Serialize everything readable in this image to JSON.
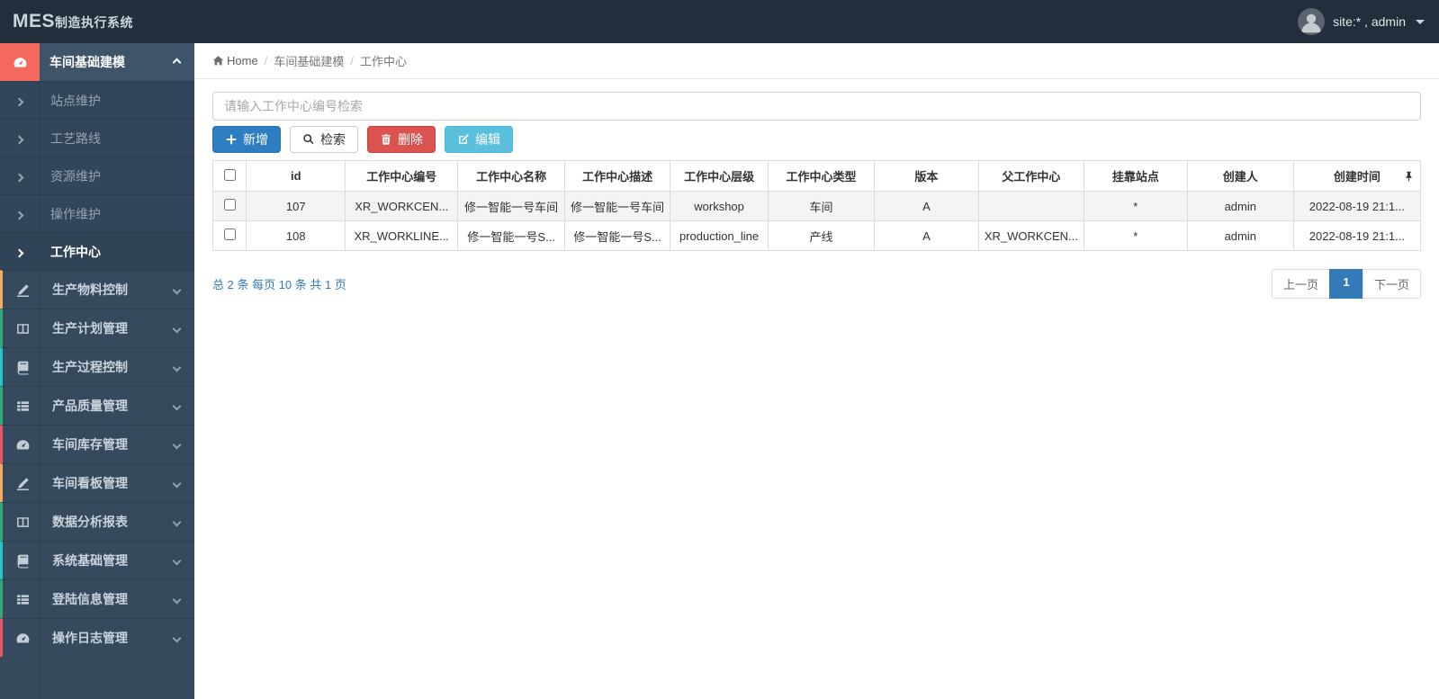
{
  "topbar": {
    "logo_primary": "MES",
    "logo_secondary": "制造执行系统",
    "user_label": "site:* , admin"
  },
  "sidebar": {
    "items": [
      {
        "label": "车间基础建模",
        "icon": "dashboard-icon",
        "accent": "#f4695e",
        "expanded": true,
        "children": [
          {
            "label": "站点维护"
          },
          {
            "label": "工艺路线"
          },
          {
            "label": "资源维护"
          },
          {
            "label": "操作维护"
          },
          {
            "label": "工作中心",
            "active": true
          }
        ]
      },
      {
        "label": "生产物料控制",
        "icon": "pencil-icon",
        "accent": "#f8ac59"
      },
      {
        "label": "生产计划管理",
        "icon": "columns-icon",
        "accent": "#2faa7a"
      },
      {
        "label": "生产过程控制",
        "icon": "book-icon",
        "accent": "#23c6c8"
      },
      {
        "label": "产品质量管理",
        "icon": "list-icon",
        "accent": "#2faa7a"
      },
      {
        "label": "车间库存管理",
        "icon": "dashboard-icon",
        "accent": "#ed5565"
      },
      {
        "label": "车间看板管理",
        "icon": "pencil-icon",
        "accent": "#f8ac59"
      },
      {
        "label": "数据分析报表",
        "icon": "columns-icon",
        "accent": "#2faa7a"
      },
      {
        "label": "系统基础管理",
        "icon": "book-icon",
        "accent": "#23c6c8"
      },
      {
        "label": "登陆信息管理",
        "icon": "list-icon",
        "accent": "#2faa7a"
      },
      {
        "label": "操作日志管理",
        "icon": "dashboard-icon",
        "accent": "#ed5565"
      }
    ]
  },
  "breadcrumb": {
    "home": "Home",
    "crumb1": "车间基础建模",
    "crumb2": "工作中心"
  },
  "toolbar": {
    "search_placeholder": "请输入工作中心编号检索",
    "add_label": "新增",
    "search_label": "检索",
    "delete_label": "删除",
    "edit_label": "编辑"
  },
  "table": {
    "headers": [
      "id",
      "工作中心编号",
      "工作中心名称",
      "工作中心描述",
      "工作中心层级",
      "工作中心类型",
      "版本",
      "父工作中心",
      "挂靠站点",
      "创建人",
      "创建时间"
    ],
    "rows": [
      [
        "107",
        "XR_WORKCEN...",
        "修一智能一号车间",
        "修一智能一号车间",
        "workshop",
        "车间",
        "A",
        "",
        "*",
        "admin",
        "2022-08-19 21:1..."
      ],
      [
        "108",
        "XR_WORKLINE...",
        "修一智能一号S...",
        "修一智能一号S...",
        "production_line",
        "产线",
        "A",
        "XR_WORKCEN...",
        "*",
        "admin",
        "2022-08-19 21:1..."
      ]
    ]
  },
  "pagination": {
    "total": "总 2 条",
    "per_page": "每页 10 条",
    "pages": "共 1 页",
    "prev_label": "上一页",
    "current_page": "1",
    "next_label": "下一页"
  },
  "colors": {
    "topbar_bg": "#232e3d",
    "sidebar_bg": "#364a5e",
    "active_group_bg": "#3e5469",
    "group_icon_red": "#f4695e",
    "primary_blue": "#2d7fc1",
    "danger_red": "#d9534f",
    "info_cyan": "#5bc0de",
    "active_page_blue": "#337ab7"
  }
}
